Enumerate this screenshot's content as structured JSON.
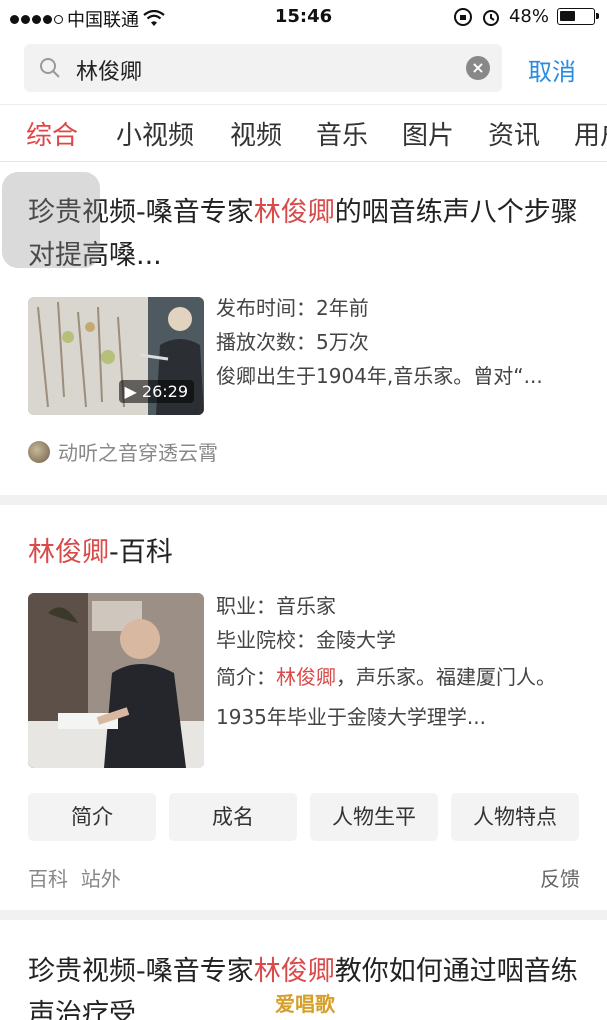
{
  "status_bar": {
    "carrier": "中国联通",
    "time": "15:46",
    "battery_text": "48%",
    "battery_level": 0.48
  },
  "search": {
    "query": "林俊卿",
    "cancel_label": "取消"
  },
  "tabs": [
    "综合",
    "小视频",
    "视频",
    "音乐",
    "图片",
    "资讯",
    "用户"
  ],
  "card1": {
    "title_pre": "珍贵视频-嗓音专家",
    "title_hl": "林俊卿",
    "title_post": "的咽音练声八个步骤对提高嗓...",
    "duration": "26:29",
    "meta": [
      "发布时间：2年前",
      "播放次数：5万次",
      "俊卿出生于1904年,音乐家。曾对“..."
    ],
    "source": "动听之音穿透云霄"
  },
  "card2": {
    "title_hl": "林俊卿",
    "title_post": "-百科",
    "meta1": "职业：音乐家",
    "meta2": "毕业院校：金陵大学",
    "meta3_pre": "简介：",
    "meta3_hl": "林俊卿",
    "meta3_post": "，声乐家。福建厦门人。1935年毕业于金陵大学理学...",
    "chips": [
      "简介",
      "成名",
      "人物生平",
      "人物特点"
    ],
    "footer_left": "百科  站外",
    "footer_right": "反馈"
  },
  "card3": {
    "title_pre": "珍贵视频-嗓音专家",
    "title_hl": "林俊卿",
    "title_post": "教你如何通过咽音练声治疗受"
  },
  "watermark": "爱唱歌",
  "colors": {
    "highlight": "#d94a4a",
    "accent_blue": "#2a8be0",
    "active_tab": "#e04545"
  }
}
